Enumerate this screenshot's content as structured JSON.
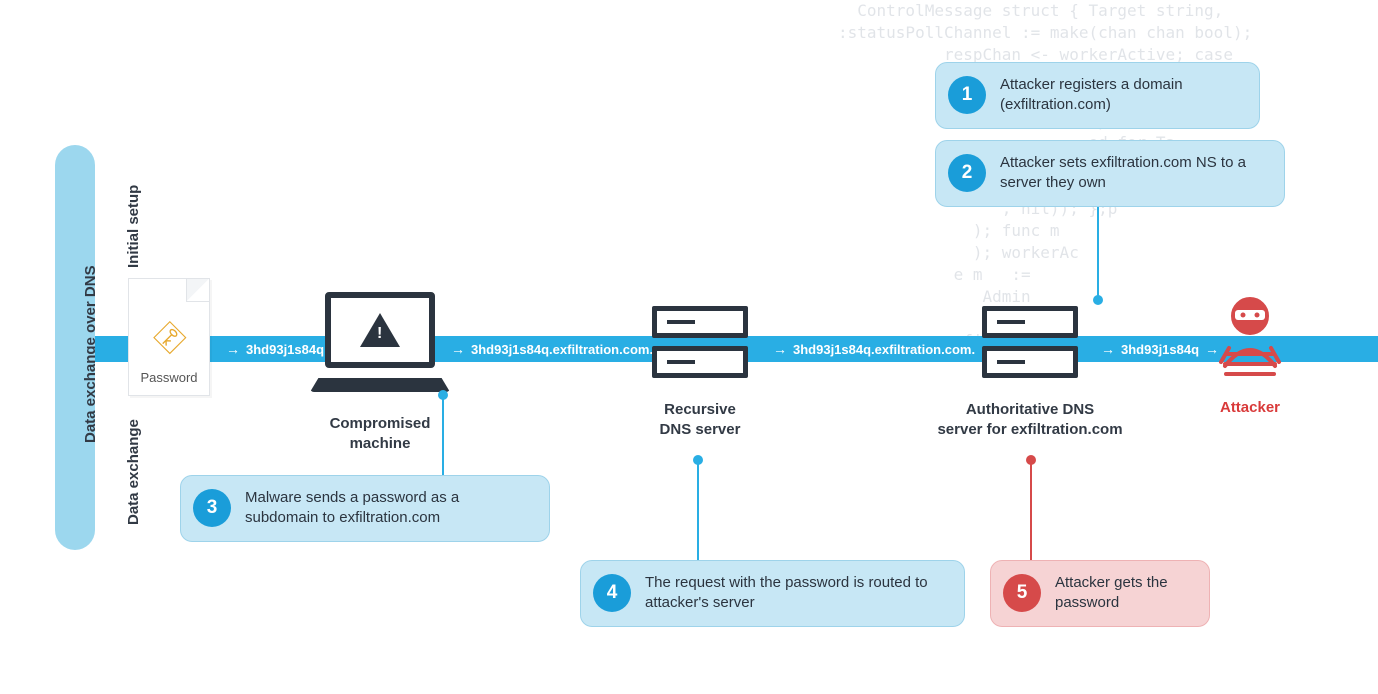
{
  "title": "Data exchange over DNS",
  "sections": {
    "top": "Initial setup",
    "bottom": "Data exchange"
  },
  "file": {
    "label": "Password"
  },
  "flow": {
    "t1": "3hd93j1s84q",
    "t2": "3hd93j1s84q.exfiltration.com.",
    "t3": "3hd93j1s84q.exfiltration.com.",
    "t4": "3hd93j1s84q"
  },
  "nodes": {
    "compromised": "Compromised\nmachine",
    "recursive": "Recursive\nDNS server",
    "authoritative": "Authoritative DNS\nserver for exfiltration.com",
    "attacker": "Attacker"
  },
  "steps": {
    "s1": {
      "n": "1",
      "txt": "Attacker registers a domain (exfiltration.com)"
    },
    "s2": {
      "n": "2",
      "txt": "Attacker sets exfiltration.com NS to a server they own"
    },
    "s3": {
      "n": "3",
      "txt": "Malware sends a password as a subdomain to exfiltration.com"
    },
    "s4": {
      "n": "4",
      "txt": "The request with the password is routed to attacker's server"
    },
    "s5": {
      "n": "5",
      "txt": "Attacker gets the password"
    }
  },
  "bgcode": "  ControlMessage struct { Target string,\n:statusPollChannel := make(chan chan bool);\n           respChan <- workerActive; case\n                    rActi e = status;\n                     q  st) { hostT\n                     [  t.Fprintf(w,\n                          ed for Ta\n                       {  reqChan\n                          \"ACTIVE\"\n                 , nil)); };p\n              ); func m\n              ); workerAc\n            e m   := \n               Admin\n                 \n             fil\n"
}
